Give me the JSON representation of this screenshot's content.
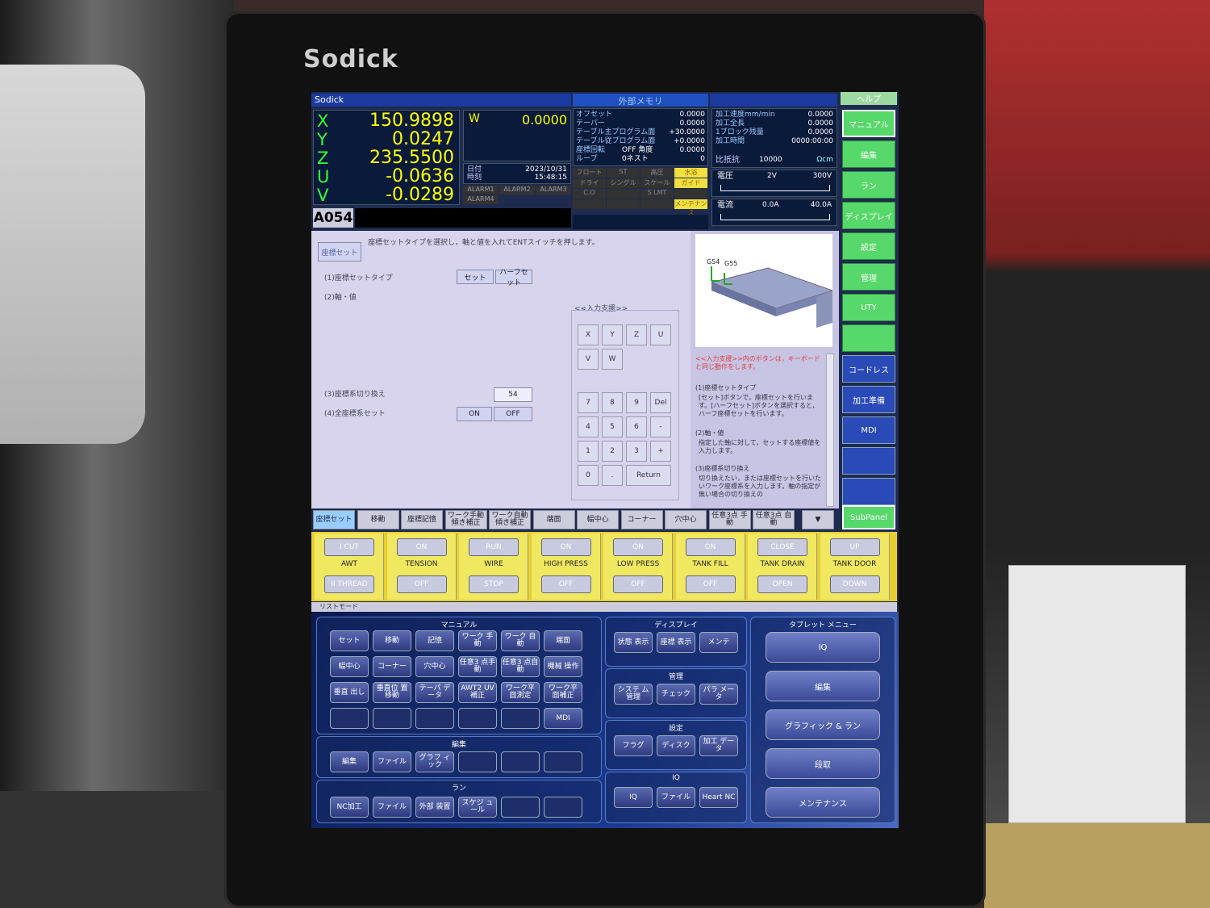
{
  "brand": "Sodick",
  "top": {
    "app": "Sodick",
    "ext_mem": "外部メモリ",
    "help": "ヘルプ"
  },
  "axes": [
    {
      "n": "X",
      "v": "150.9898"
    },
    {
      "n": "Y",
      "v": "0.0247"
    },
    {
      "n": "Z",
      "v": "235.5500"
    },
    {
      "n": "U",
      "v": "-0.0636"
    },
    {
      "n": "V",
      "v": "-0.0289"
    }
  ],
  "w": {
    "n": "W",
    "v": "0.0000"
  },
  "date": {
    "d_lbl": "日付",
    "t_lbl": "時刻",
    "d": "2023/10/31",
    "t": "15:48:15"
  },
  "alarms": [
    "ALARM1",
    "ALARM2",
    "ALARM3",
    "ALARM4"
  ],
  "code": "A054",
  "mem": [
    {
      "k": "オフセット",
      "v": "0.0000"
    },
    {
      "k": "テーパー",
      "v": "0.0000"
    },
    {
      "k": "テーブル主プログラム面",
      "v": "+30.0000"
    },
    {
      "k": "テーブル従プログラム面",
      "v": "+0.0000"
    },
    {
      "k": "座標回転",
      "m": "OFF 角度",
      "v": "0.0000"
    },
    {
      "k": "ループ",
      "m": "0ネスト",
      "v": "0"
    }
  ],
  "modes": [
    "フロート",
    "ST",
    "高圧",
    "水浴",
    "ドライ",
    "シングル",
    "スケール",
    "ガイド",
    "C.O",
    "",
    "S LMT",
    "",
    "",
    "",
    "",
    "メンテナンス"
  ],
  "stat": [
    {
      "k": "加工速度mm/min",
      "v": "0.0000"
    },
    {
      "k": "加工全長",
      "v": "0.0000"
    },
    {
      "k": "1ブロック残量",
      "v": "0.0000"
    },
    {
      "k": "加工時間",
      "v": "0000:00:00"
    }
  ],
  "res": {
    "k": "比抵抗",
    "v": "10000",
    "u": "Ωcm"
  },
  "volt": {
    "k": "電圧",
    "a": "2V",
    "b": "300V"
  },
  "amp": {
    "k": "電流",
    "a": "0.0A",
    "b": "40.0A"
  },
  "side": [
    "マニュアル",
    "編集",
    "ラン",
    "ディスプレイ",
    "設定",
    "管理",
    "UTY",
    "",
    "コードレス",
    "加工準備",
    "MDI",
    "",
    ""
  ],
  "subpanel": "SubPanel",
  "form": {
    "title": "座標セット",
    "desc": "座標セットタイプを選択し，軸と値を入れてENTスイッチを押します。",
    "l1": "(1)座標セットタイプ",
    "b1": "セット",
    "b2": "ハーフセット",
    "l2": "(2)軸・値",
    "l3": "(3)座標系切り換え",
    "v3": "54",
    "l4": "(4)全座標系セット",
    "on": "ON",
    "off": "OFF",
    "assist": "<<入力支援>>",
    "keys": [
      "X",
      "Y",
      "Z",
      "U",
      "V",
      "W"
    ],
    "nums": [
      "7",
      "8",
      "9",
      "Del",
      "4",
      "5",
      "6",
      "-",
      "1",
      "2",
      "3",
      "+",
      "0",
      ".",
      "Return"
    ]
  },
  "help": {
    "g1": "G54",
    "g2": "G55",
    "t1": "<<入力支援>>内のボタンは，キーボードと同じ動作をします。",
    "t2": "(1)座標セットタイプ",
    "t3": "[セット]ボタンで，座標セットを行います。[ハーフセット]ボタンを選択すると，ハーフ座標セットを行います。",
    "t4": "(2)軸・値",
    "t5": "指定した軸に対して，セットする座標値を入力します。",
    "t6": "(3)座標系切り換え",
    "t7": "切り換えたい，または座標セットを行いたいワーク座標系を入力します。軸の指定が無い場合の切り換えの"
  },
  "tabs": [
    "座標セット",
    "移動",
    "座標記憶",
    "ワーク手動 傾き補正",
    "ワーク自動 傾き補正",
    "端面",
    "幅中心",
    "コーナー",
    "穴中心",
    "任意3点 手動",
    "任意3点 自動",
    "▼"
  ],
  "ctl": [
    {
      "top": "I CUT",
      "mid": "AWT",
      "bot": "II THREAD"
    },
    {
      "top": "ON",
      "mid": "TENSION",
      "bot": "OFF"
    },
    {
      "top": "RUN",
      "mid": "WIRE",
      "bot": "STOP"
    },
    {
      "top": "ON",
      "mid": "HIGH PRESS",
      "bot": "OFF"
    },
    {
      "top": "ON",
      "mid": "LOW PRESS",
      "bot": "OFF"
    },
    {
      "top": "ON",
      "mid": "TANK FILL",
      "bot": "OFF"
    },
    {
      "top": "CLOSE",
      "mid": "TANK DRAIN",
      "bot": "OPEN"
    },
    {
      "top": "UP",
      "mid": "TANK DOOR",
      "bot": "DOWN"
    }
  ],
  "listmode": "リストモード",
  "manual": {
    "title": "マニュアル",
    "keys": [
      "セット",
      "移動",
      "記憶",
      "ワーク 手動",
      "ワーク 自動",
      "端面",
      "幅中心",
      "コーナー",
      "穴中心",
      "任意3 点手動",
      "任意3 点自動",
      "機械 操作",
      "垂直 出し",
      "垂直位 置移動",
      "テーパ データ",
      "AWT2 UV補正",
      "ワーク平 面測定",
      "ワーク平 面補正",
      "",
      "",
      "",
      "",
      "",
      "MDI"
    ]
  },
  "edit": {
    "title": "編集",
    "keys": [
      "編集",
      "ファイル",
      "グラフ ィック",
      "",
      "",
      ""
    ]
  },
  "run": {
    "title": "ラン",
    "keys": [
      "NC加工",
      "ファイル",
      "外部 装置",
      "スケジ ュール",
      "",
      ""
    ]
  },
  "disp": {
    "title": "ディスプレイ",
    "keys": [
      "状態 表示",
      "座標 表示",
      "メンテ"
    ]
  },
  "mgmt": {
    "title": "管理",
    "keys": [
      "システ ム管理",
      "チェック",
      "パラ メータ"
    ]
  },
  "cfg": {
    "title": "設定",
    "keys": [
      "フラグ",
      "ディスク",
      "加工 データ"
    ]
  },
  "iq": {
    "title": "IQ",
    "keys": [
      "IQ",
      "ファイル",
      "Heart NC"
    ]
  },
  "tablet": {
    "title": "タブレット メニュー",
    "keys": [
      "IQ",
      "編集",
      "グラフィック & ラン",
      "段取",
      "メンテナンス"
    ]
  }
}
